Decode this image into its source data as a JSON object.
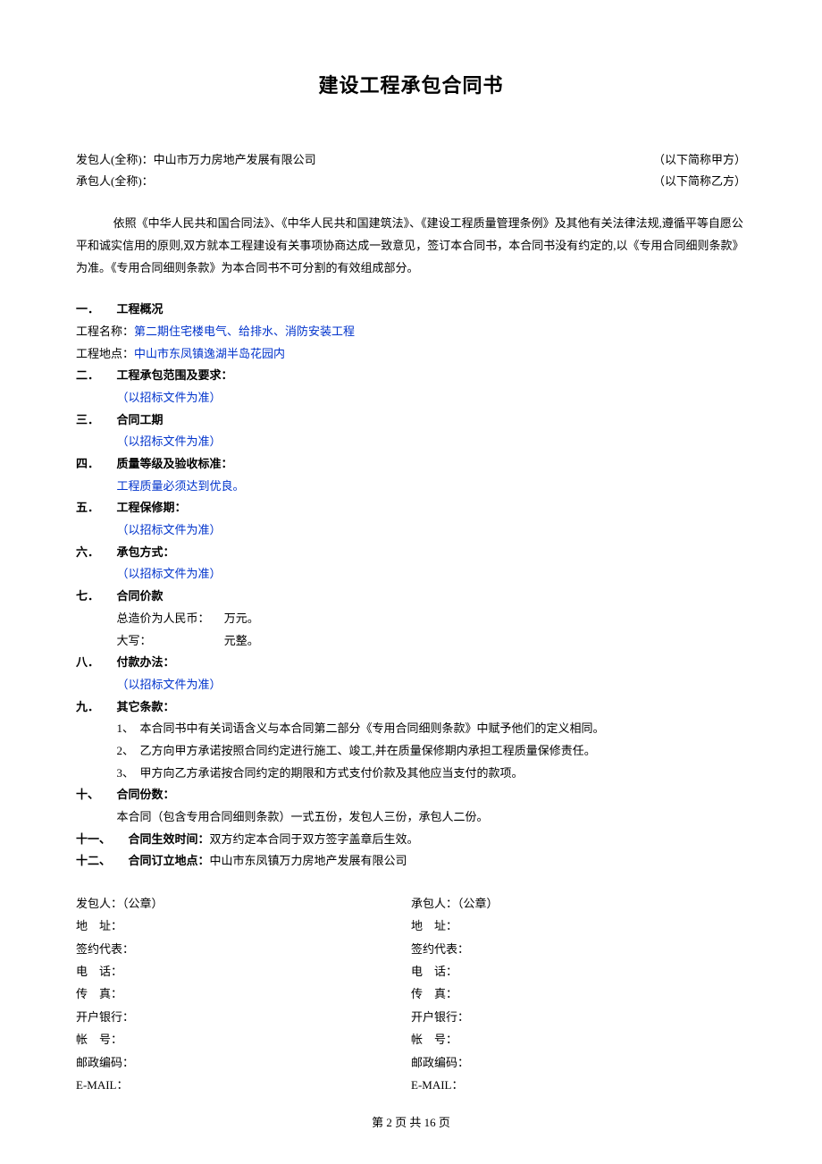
{
  "title": "建设工程承包合同书",
  "party_a_label": "发包人(全称)：",
  "party_a_name": "中山市万力房地产发展有限公司",
  "party_a_alias": "（以下简称甲方）",
  "party_b_label": "承包人(全称)：",
  "party_b_name": "",
  "party_b_alias": "（以下简称乙方）",
  "intro": "依照《中华人民共和国合同法》、《中华人民共和国建筑法》、《建设工程质量管理条例》及其他有关法律法规,遵循平等自愿公平和诚实信用的原则,双方就本工程建设有关事项协商达成一致意见，签订本合同书，本合同书没有约定的,以《专用合同细则条款》为准。《专用合同细则条款》为本合同书不可分割的有效组成部分。",
  "s1_num": "一．",
  "s1_title": "工程概况",
  "s1_name_label": "工程名称：",
  "s1_name_value": "第二期住宅楼电气、给排水、消防安装工程",
  "s1_loc_label": "工程地点：",
  "s1_loc_value": "中山市东凤镇逸湖半岛花园内",
  "s2_num": "二．",
  "s2_title": "工程承包范围及要求：",
  "s2_content": "（以招标文件为准）",
  "s3_num": "三．",
  "s3_title": "合同工期",
  "s3_content": "（以招标文件为准）",
  "s4_num": "四．",
  "s4_title": "质量等级及验收标准：",
  "s4_content": "工程质量必须达到优良。",
  "s5_num": "五．",
  "s5_title": "工程保修期：",
  "s5_content": "（以招标文件为准）",
  "s6_num": "六．",
  "s6_title": "承包方式：",
  "s6_content": "（以招标文件为准）",
  "s7_num": "七．",
  "s7_title": "合同价款",
  "s7_row1_label": "总造价为人民币：",
  "s7_row1_unit": "万元。",
  "s7_row2_label": "大写：",
  "s7_row2_unit": "元整。",
  "s8_num": "八．",
  "s8_title": "付款办法：",
  "s8_content": "（以招标文件为准）",
  "s9_num": "九．",
  "s9_title": "其它条款：",
  "s9_items": [
    {
      "num": "1、",
      "text": "本合同书中有关词语含义与本合同第二部分《专用合同细则条款》中赋予他们的定义相同。"
    },
    {
      "num": "2、",
      "text": "乙方向甲方承诺按照合同约定进行施工、竣工,并在质量保修期内承担工程质量保修责任。"
    },
    {
      "num": "3、",
      "text": "甲方向乙方承诺按合同约定的期限和方式支付价款及其他应当支付的款项。"
    }
  ],
  "s10_num": "十、",
  "s10_title": "合同份数：",
  "s10_content": "本合同（包含专用合同细则条款）一式五份，发包人三份，承包人二份。",
  "s11_num": "十一、",
  "s11_title": "合同生效时间：",
  "s11_content": " 双方约定本合同于双方签字盖章后生效。",
  "s12_num": "十二、",
  "s12_title": "合同订立地点：",
  "s12_content": "中山市东凤镇万力房地产发展有限公司",
  "sig": {
    "left_header": "发包人：（公章）",
    "right_header": "承包人：（公章）",
    "addr": "地　址：",
    "rep": "签约代表：",
    "tel": "电　话：",
    "fax": "传　真：",
    "bank": "开户银行：",
    "acct": "帐　号：",
    "zip": "邮政编码：",
    "email": "E-MAIL："
  },
  "footer": "第 2 页 共 16 页"
}
